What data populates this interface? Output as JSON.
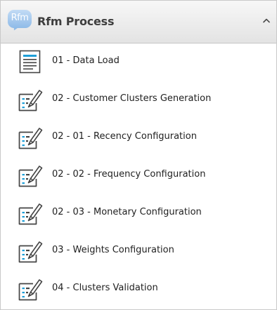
{
  "panel": {
    "title": "Rfm Process",
    "logo_text": "Rfm",
    "logo_icon": "speech-bubble-logo-icon",
    "collapse_icon": "chevron-up-icon",
    "colors": {
      "logo_light": "#c2dbf5",
      "logo_dark": "#8fbbe8",
      "header_top": "#f7f7f7",
      "header_bottom": "#e3e3e3",
      "icon_dark": "#444444",
      "icon_accent": "#1e9fd8"
    }
  },
  "items": [
    {
      "label": "01 - Data Load",
      "icon": "document-lines-icon"
    },
    {
      "label": "02 - Customer Clusters Generation",
      "icon": "edit-form-icon"
    },
    {
      "label": "02 - 01 - Recency Configuration",
      "icon": "edit-form-icon"
    },
    {
      "label": "02 - 02 - Frequency Configuration",
      "icon": "edit-form-icon"
    },
    {
      "label": "02 - 03 - Monetary Configuration",
      "icon": "edit-form-icon"
    },
    {
      "label": "03 - Weights Configuration",
      "icon": "edit-form-icon"
    },
    {
      "label": "04 - Clusters Validation",
      "icon": "edit-form-icon"
    }
  ]
}
